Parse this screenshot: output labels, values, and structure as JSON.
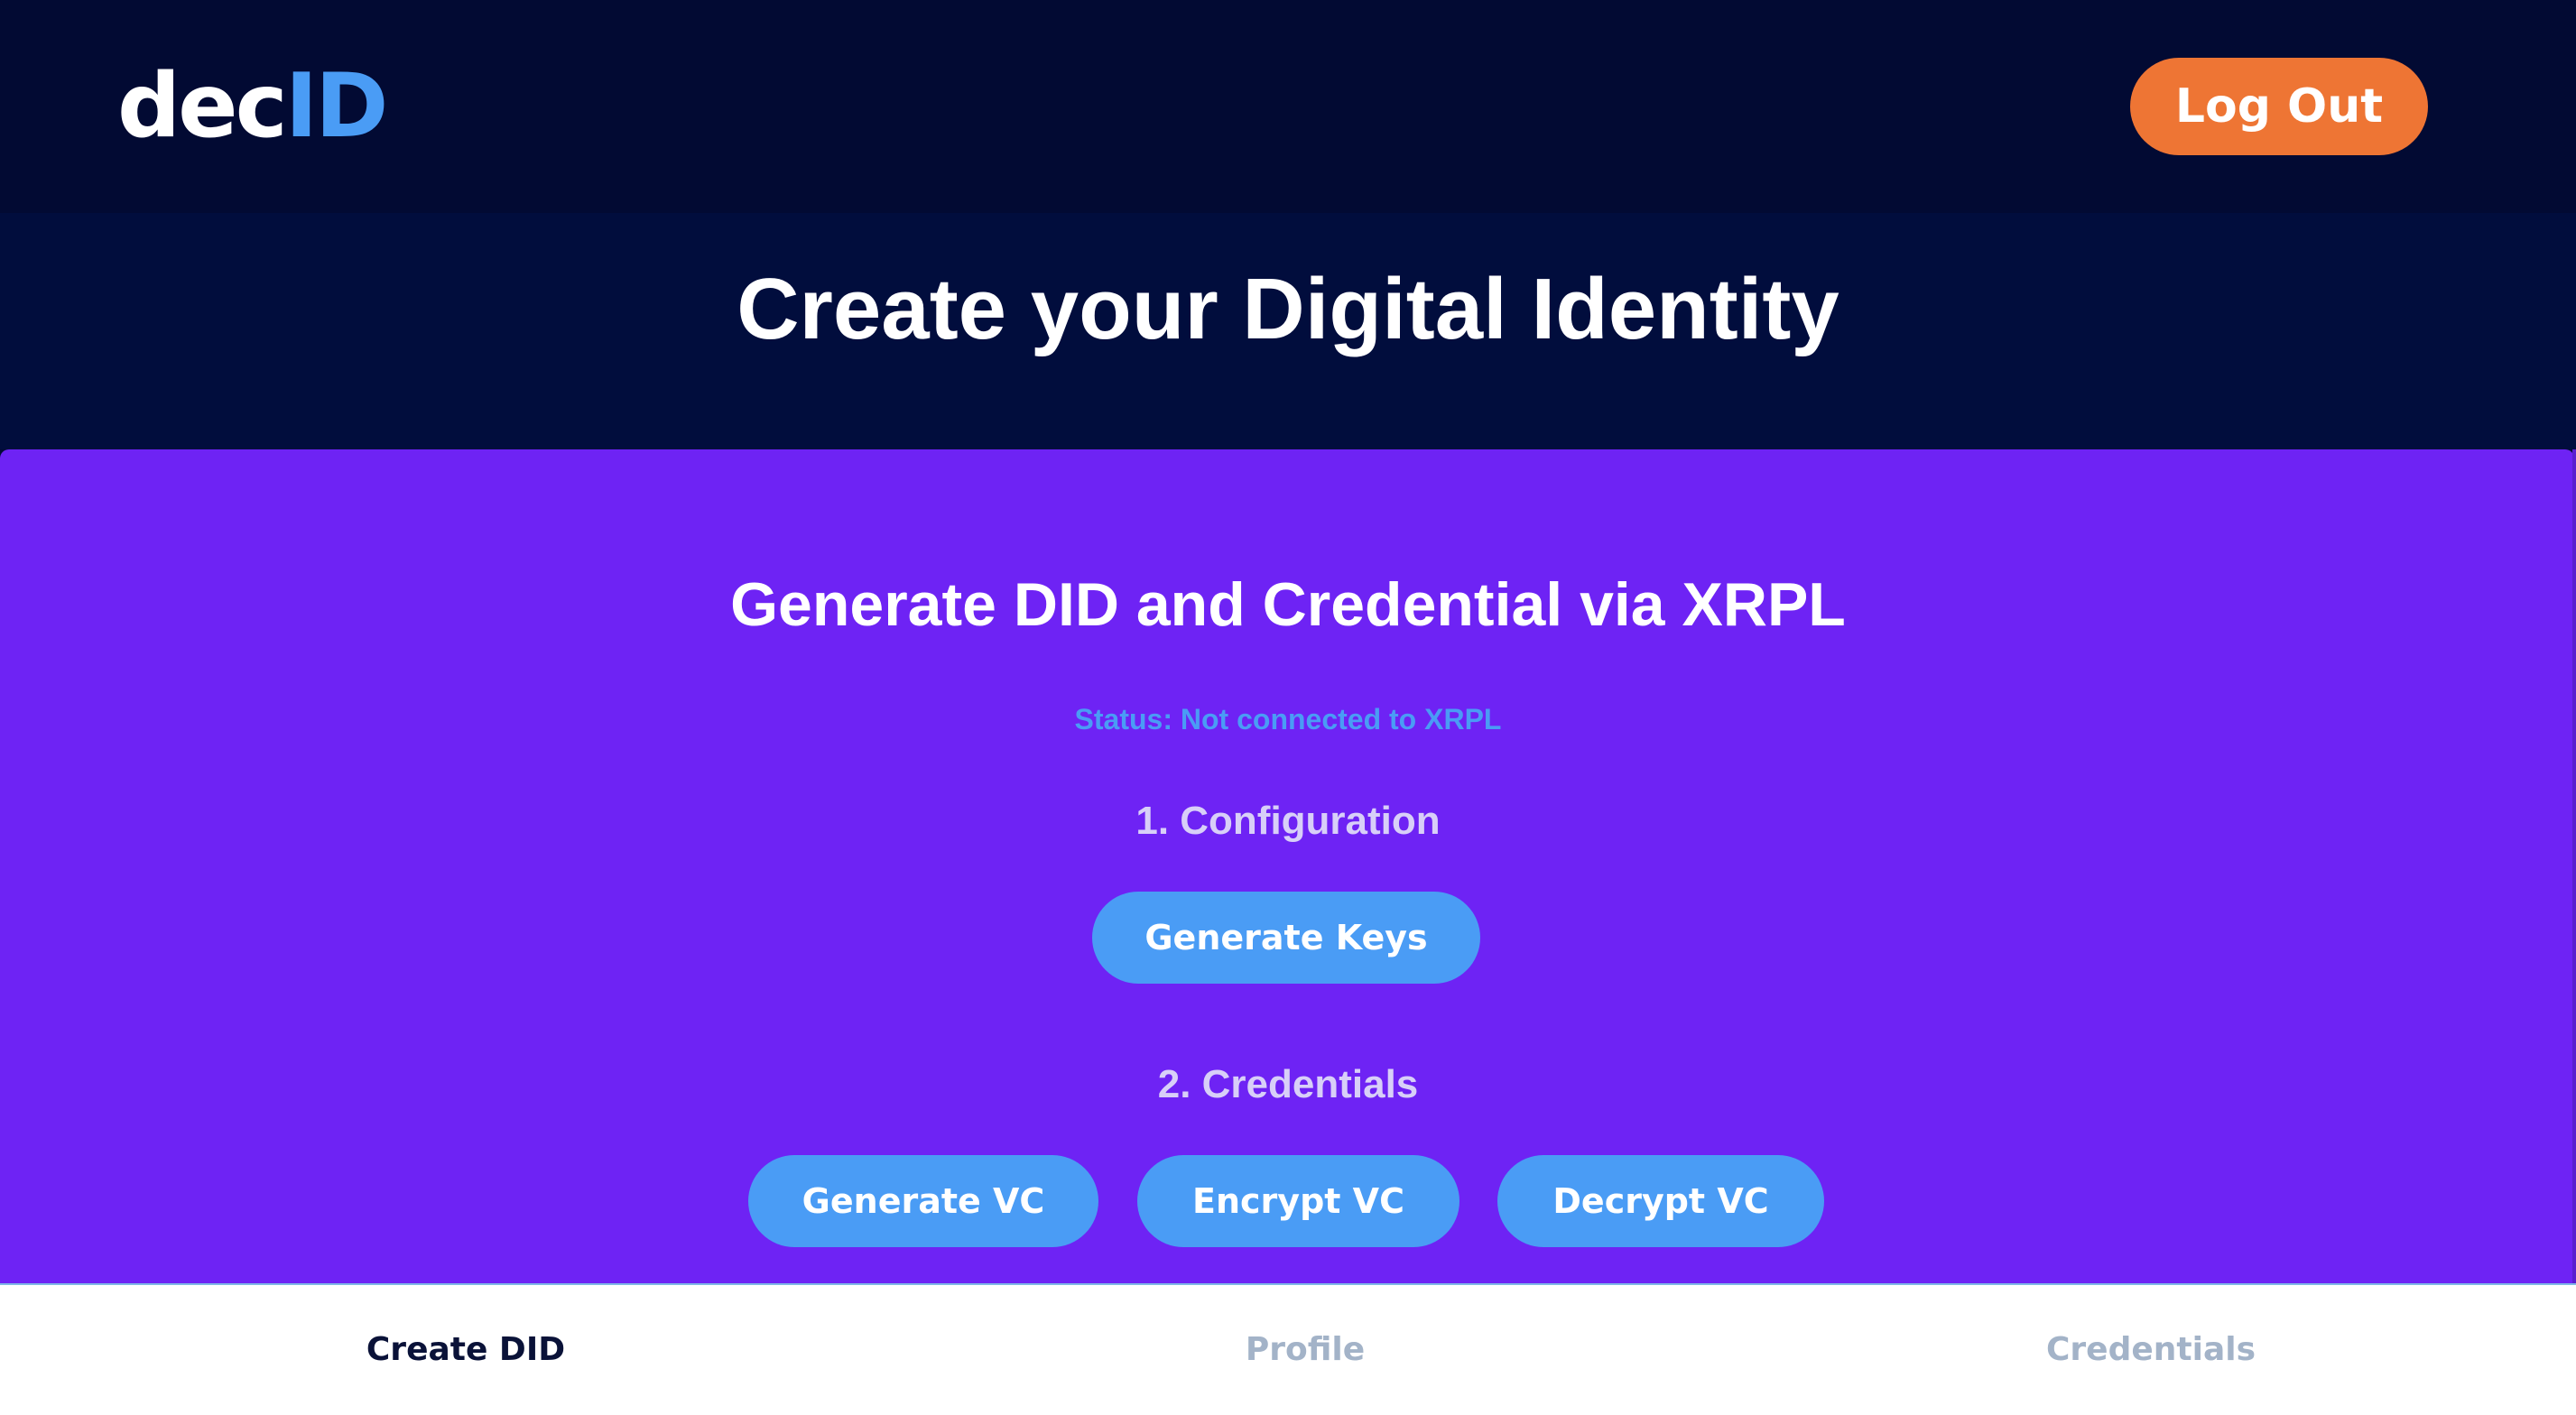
{
  "header": {
    "logo_part1": "dec",
    "logo_part2": "ID",
    "logout_label": "Log Out"
  },
  "page": {
    "title": "Create your Digital Identity"
  },
  "panel": {
    "heading": "Generate DID and Credential via XRPL",
    "status": "Status: Not connected to XRPL",
    "step1": {
      "heading": "1. Configuration",
      "buttons": [
        "Generate Keys"
      ]
    },
    "step2": {
      "heading": "2. Credentials",
      "buttons": [
        "Generate VC",
        "Encrypt VC",
        "Decrypt VC"
      ]
    }
  },
  "bottom_nav": {
    "items": [
      {
        "label": "Create DID",
        "active": true
      },
      {
        "label": "Profile",
        "active": false
      },
      {
        "label": "Credentials",
        "active": false
      }
    ]
  },
  "colors": {
    "header_bg": "#020a33",
    "panel_bg": "#6e23f4",
    "accent_blue": "#4a9cf5",
    "logout_orange": "#ee7534",
    "nav_active": "#0a1238",
    "nav_inactive": "#a3b3c8"
  }
}
